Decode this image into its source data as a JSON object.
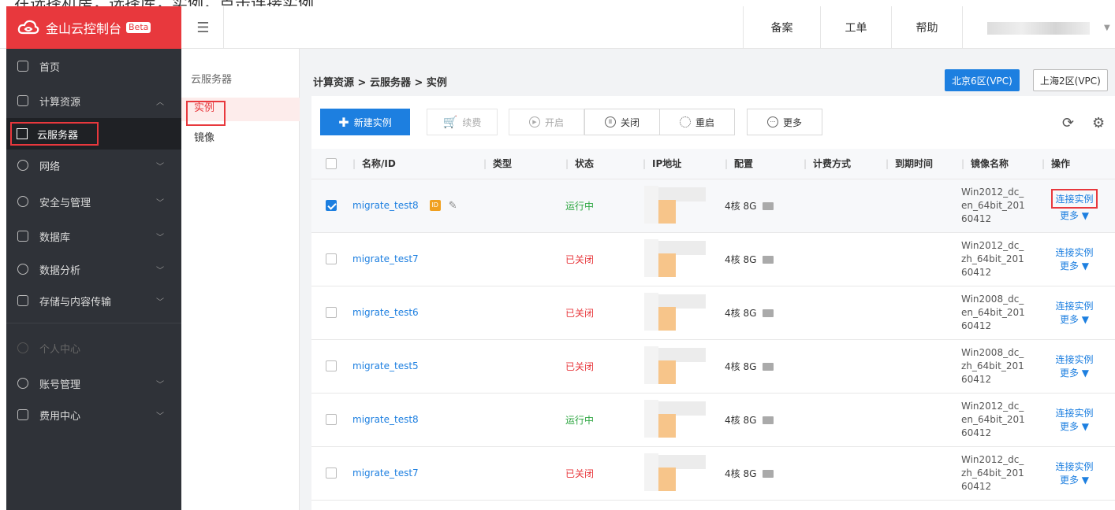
{
  "top_strip_text": "在选择机房，选择库，实例，点击连接实例",
  "header": {
    "logo_text": "金山云控制台",
    "beta": "Beta",
    "nav": [
      "备案",
      "工单",
      "帮助"
    ]
  },
  "sidebar": {
    "items": [
      {
        "label": "首页"
      },
      {
        "label": "计算资源"
      },
      {
        "label": "云服务器"
      },
      {
        "label": "网络"
      },
      {
        "label": "安全与管理"
      },
      {
        "label": "数据库"
      },
      {
        "label": "数据分析"
      },
      {
        "label": "存储与内容传输"
      },
      {
        "label": "个人中心"
      },
      {
        "label": "账号管理"
      },
      {
        "label": "费用中心"
      }
    ]
  },
  "subnav": {
    "title": "云服务器",
    "active": "实例",
    "image": "镜像"
  },
  "breadcrumb": "计算资源 > 云服务器 > 实例",
  "regions": [
    "北京6区(VPC)",
    "上海2区(VPC)"
  ],
  "toolbar": {
    "new": "新建实例",
    "renew": "续费",
    "start": "开启",
    "stop": "关闭",
    "restart": "重启",
    "more": "更多"
  },
  "table": {
    "columns": [
      "名称/ID",
      "类型",
      "状态",
      "IP地址",
      "配置",
      "计费方式",
      "到期时间",
      "镜像名称",
      "操作"
    ],
    "rows": [
      {
        "name": "migrate_test8",
        "status": "运行中",
        "config": "4核 8G",
        "image": "Win2012_dc_en_64bit_20160412",
        "op": "连接实例",
        "more": "更多 ▼"
      },
      {
        "name": "migrate_test7",
        "status": "已关闭",
        "config": "4核 8G",
        "image": "Win2012_dc_zh_64bit_20160412",
        "op": "连接实例",
        "more": "更多 ▼"
      },
      {
        "name": "migrate_test6",
        "status": "已关闭",
        "config": "4核 8G",
        "image": "Win2008_dc_en_64bit_20160412",
        "op": "连接实例",
        "more": "更多 ▼"
      },
      {
        "name": "migrate_test5",
        "status": "已关闭",
        "config": "4核 8G",
        "image": "Win2008_dc_zh_64bit_20160412",
        "op": "连接实例",
        "more": "更多 ▼"
      },
      {
        "name": "migrate_test8",
        "status": "运行中",
        "config": "4核 8G",
        "image": "Win2012_dc_en_64bit_20160412",
        "op": "连接实例",
        "more": "更多 ▼"
      },
      {
        "name": "migrate_test7",
        "status": "已关闭",
        "config": "4核 8G",
        "image": "Win2012_dc_zh_64bit_20160412",
        "op": "连接实例",
        "more": "更多 ▼"
      }
    ]
  },
  "colors": {
    "brand": "#e8383d",
    "primary": "#1d7fe0",
    "running": "#2da641",
    "stopped": "#e8383d"
  }
}
